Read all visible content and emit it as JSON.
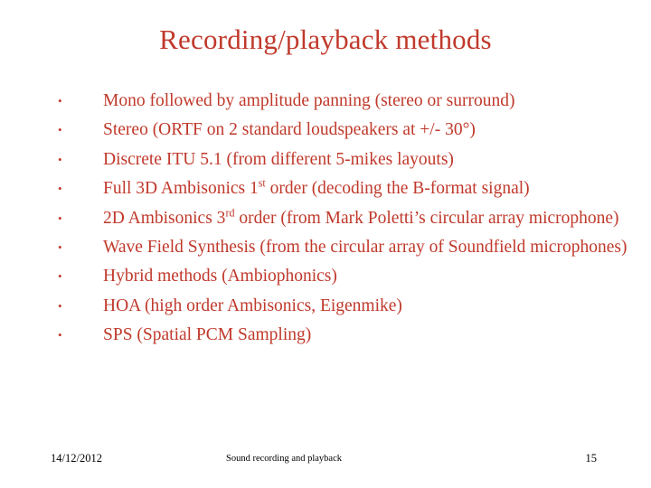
{
  "slide": {
    "title": "Recording/playback methods",
    "bullet_glyph": "•",
    "accent_color": "#C0392B",
    "bullets": [
      {
        "text": "Mono followed by amplitude panning (stereo or surround)",
        "justify": false
      },
      {
        "text": "Stereo (ORTF on 2 standard loudspeakers at +/- 30°)",
        "justify": false
      },
      {
        "text": "Discrete ITU 5.1 (from different 5-mikes layouts)",
        "justify": false
      },
      {
        "text": "Full 3D Ambisonics 1st order (decoding the B-format signal)",
        "justify": true,
        "sup": {
          "base": "Full 3D Ambisonics 1",
          "script": "st",
          "rest": " order (decoding the B-format signal)"
        }
      },
      {
        "text": "2D Ambisonics 3rd order (from Mark Poletti’s circular array microphone)",
        "justify": true,
        "sup": {
          "base": "2D Ambisonics 3",
          "script": "rd",
          "rest": " order (from Mark Poletti’s circular array microphone)"
        }
      },
      {
        "text": "Wave Field Synthesis (from the circular array of Soundfield microphones)",
        "justify": true
      },
      {
        "text": "Hybrid methods (Ambiophonics)",
        "justify": false
      },
      {
        "text": "HOA (high order Ambisonics, Eigenmike)",
        "justify": false
      },
      {
        "text": "SPS (Spatial PCM Sampling)",
        "justify": false
      }
    ]
  },
  "footer": {
    "date": "14/12/2012",
    "center": "Sound recording and playback",
    "page": "15"
  }
}
